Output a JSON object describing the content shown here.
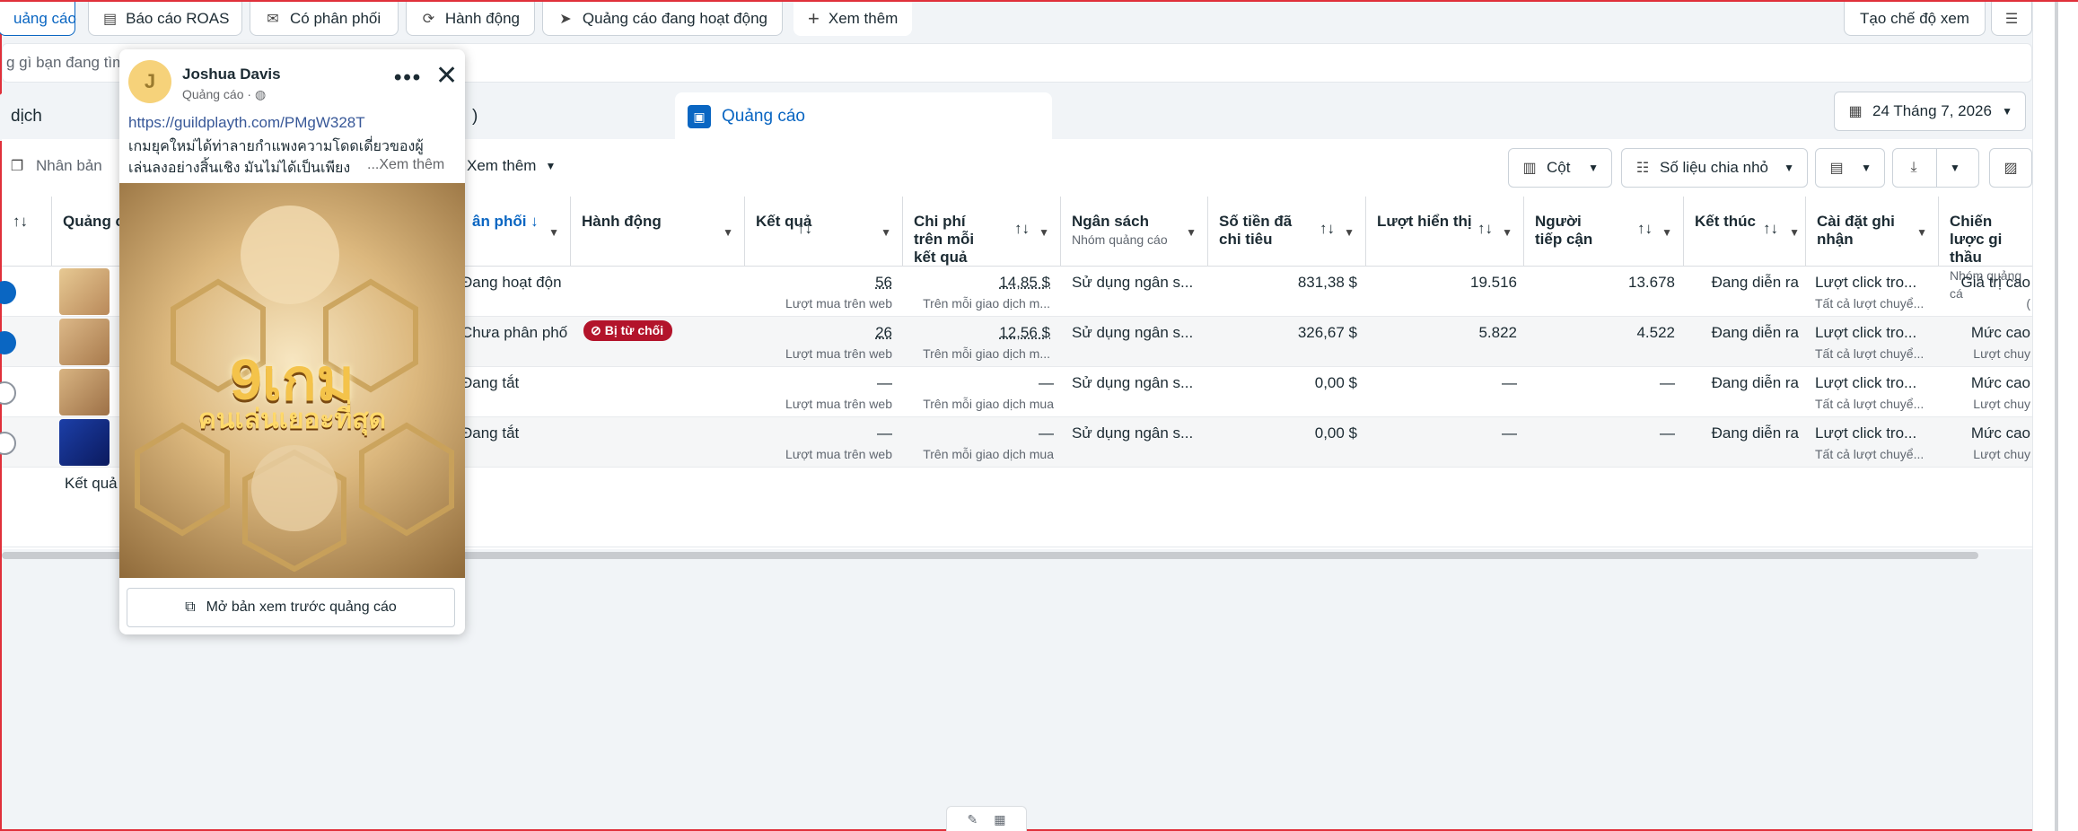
{
  "top_tabs": [
    {
      "label": "uảng cáo",
      "icon": "ad-icon"
    },
    {
      "label": "Báo cáo ROAS",
      "icon": "report-icon"
    },
    {
      "label": "Có phân phối",
      "icon": "delivery-icon"
    },
    {
      "label": "Hành động",
      "icon": "action-icon"
    },
    {
      "label": "Quảng cáo đang hoạt động",
      "icon": "send-icon"
    },
    {
      "label": "Xem thêm",
      "icon": "plus-icon"
    }
  ],
  "create_view_label": "Tạo chế độ xem",
  "search_placeholder": "g gì bạn đang tìm",
  "level_tabs": {
    "left": "dịch",
    "middle": ")",
    "active": "Quảng cáo"
  },
  "date_range": "24 Tháng 7, 2026",
  "toolbar": {
    "duplicate": "Nhân bản",
    "more": "Xem thêm",
    "columns": "Cột",
    "breakdown": "Số liệu chia nhỏ"
  },
  "columns": [
    {
      "label": "Quảng c",
      "sub": ""
    },
    {
      "label": "ân phối ↓",
      "sub": ""
    },
    {
      "label": "Hành động",
      "sub": ""
    },
    {
      "label": "Kết quả",
      "sub": ""
    },
    {
      "label": "Chi phí trên mỗi kết quả",
      "sub": ""
    },
    {
      "label": "Ngân sách",
      "sub": "Nhóm quảng cáo"
    },
    {
      "label": "Số tiền đã chi tiêu",
      "sub": ""
    },
    {
      "label": "Lượt hiển thị",
      "sub": ""
    },
    {
      "label": "Người tiếp cận",
      "sub": ""
    },
    {
      "label": "Kết thúc",
      "sub": ""
    },
    {
      "label": "Cài đặt ghi nhận",
      "sub": ""
    },
    {
      "label": "Chiến lược gi thầu",
      "sub": "Nhóm quảng cá"
    }
  ],
  "rows": [
    {
      "delivery": "Đang hoạt độn",
      "action": "",
      "result": "56",
      "result_sub": "Lượt mua trên web",
      "cpr": "14,85 $",
      "cpr_sub": "Trên mỗi giao dịch m...",
      "budget": "Sử dụng ngân s...",
      "spent": "831,38 $",
      "impressions": "19.516",
      "reach": "13.678",
      "ends": "Đang diễn ra",
      "attribution": "Lượt click tro...",
      "attribution_sub": "Tất cả lượt chuyể...",
      "bid": "Giá trị cao",
      "bid_sub": "("
    },
    {
      "delivery": "Chưa phân phố",
      "action": "Bị từ chối",
      "result": "26",
      "result_sub": "Lượt mua trên web",
      "cpr": "12,56 $",
      "cpr_sub": "Trên mỗi giao dịch m...",
      "budget": "Sử dụng ngân s...",
      "spent": "326,67 $",
      "impressions": "5.822",
      "reach": "4.522",
      "ends": "Đang diễn ra",
      "attribution": "Lượt click tro...",
      "attribution_sub": "Tất cả lượt chuyể...",
      "bid": "Mức cao",
      "bid_sub": "Lượt chuy"
    },
    {
      "delivery": "Đang tắt",
      "action": "",
      "result": "—",
      "result_sub": "Lượt mua trên web",
      "cpr": "—",
      "cpr_sub": "Trên mỗi giao dịch mua",
      "budget": "Sử dụng ngân s...",
      "spent": "0,00 $",
      "impressions": "—",
      "reach": "—",
      "ends": "Đang diễn ra",
      "attribution": "Lượt click tro...",
      "attribution_sub": "Tất cả lượt chuyể...",
      "bid": "Mức cao",
      "bid_sub": "Lượt chuy"
    },
    {
      "delivery": "Đang tắt",
      "action": "",
      "result": "—",
      "result_sub": "Lượt mua trên web",
      "cpr": "—",
      "cpr_sub": "Trên mỗi giao dịch mua",
      "budget": "Sử dụng ngân s...",
      "spent": "0,00 $",
      "impressions": "—",
      "reach": "—",
      "ends": "Đang diễn ra",
      "attribution": "Lượt click tro...",
      "attribution_sub": "Tất cả lượt chuyể...",
      "bid": "Mức cao",
      "bid_sub": "Lượt chuy"
    }
  ],
  "footer_label": "Kết quả",
  "popup": {
    "page_name": "Joshua Davis",
    "avatar_letter": "J",
    "meta": "Quảng cáo ·",
    "url": "https://guildplayth.com/PMgW328T",
    "text_line1": "เกมยุคใหม่ได้ท่าลายกำแพงความโดดเดี่ยวของผู้",
    "text_line2": "เล่นลงอย่างสิ้นเชิง มันไม่ได้เป็นเพียง",
    "see_more": "...Xem thêm",
    "banner_title": "9เกม",
    "banner_subtitle": "คนเล่นเยอะที่สุด",
    "preview_button": "Mở bản xem trước quảng cáo"
  },
  "colors": {
    "accent": "#0a66c2",
    "rejected": "#b3142b",
    "frame": "#e0303a"
  }
}
